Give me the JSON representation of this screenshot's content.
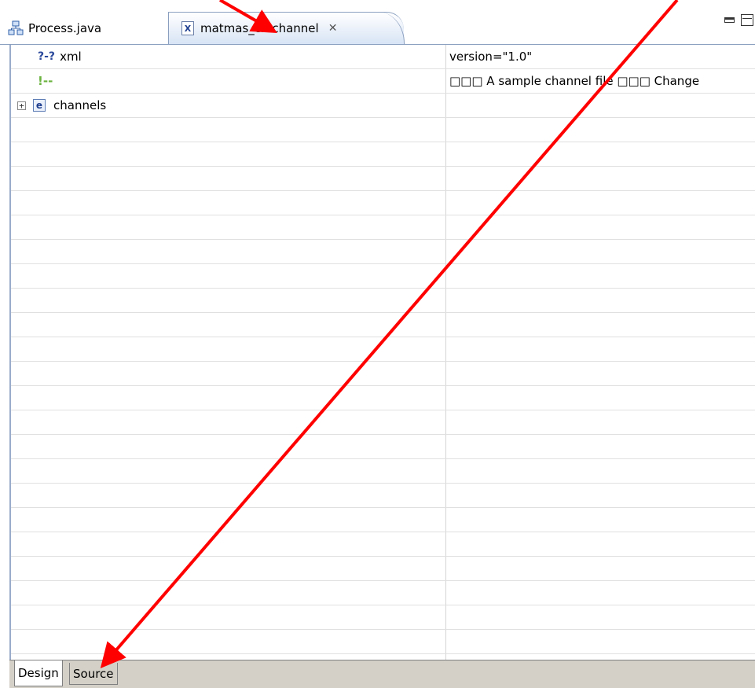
{
  "editor_tabs": [
    {
      "label": "Process.java",
      "icon": "process-diagram-icon"
    },
    {
      "label": "matmas_ch.channel",
      "icon": "xml-file-icon",
      "close_glyph": "✕"
    }
  ],
  "tree_rows": [
    {
      "icon_text": "?-?",
      "icon": "processing-instruction-icon",
      "name": "xml",
      "value": "version=\"1.0\""
    },
    {
      "icon_text": "!--",
      "icon": "comment-icon",
      "name": "",
      "value": "□□□ A sample channel file □□□ Change"
    },
    {
      "icon_text": "e",
      "icon": "element-icon",
      "expand": "+",
      "name": "channels",
      "value": ""
    }
  ],
  "bottom_tabs": [
    {
      "label": "Design"
    },
    {
      "label": "Source"
    }
  ],
  "colors": {
    "annotation_arrow": "#ff0000",
    "active_tab_gradient_end": "#d8e4f5",
    "bottom_bar": "#d4d0c8"
  }
}
